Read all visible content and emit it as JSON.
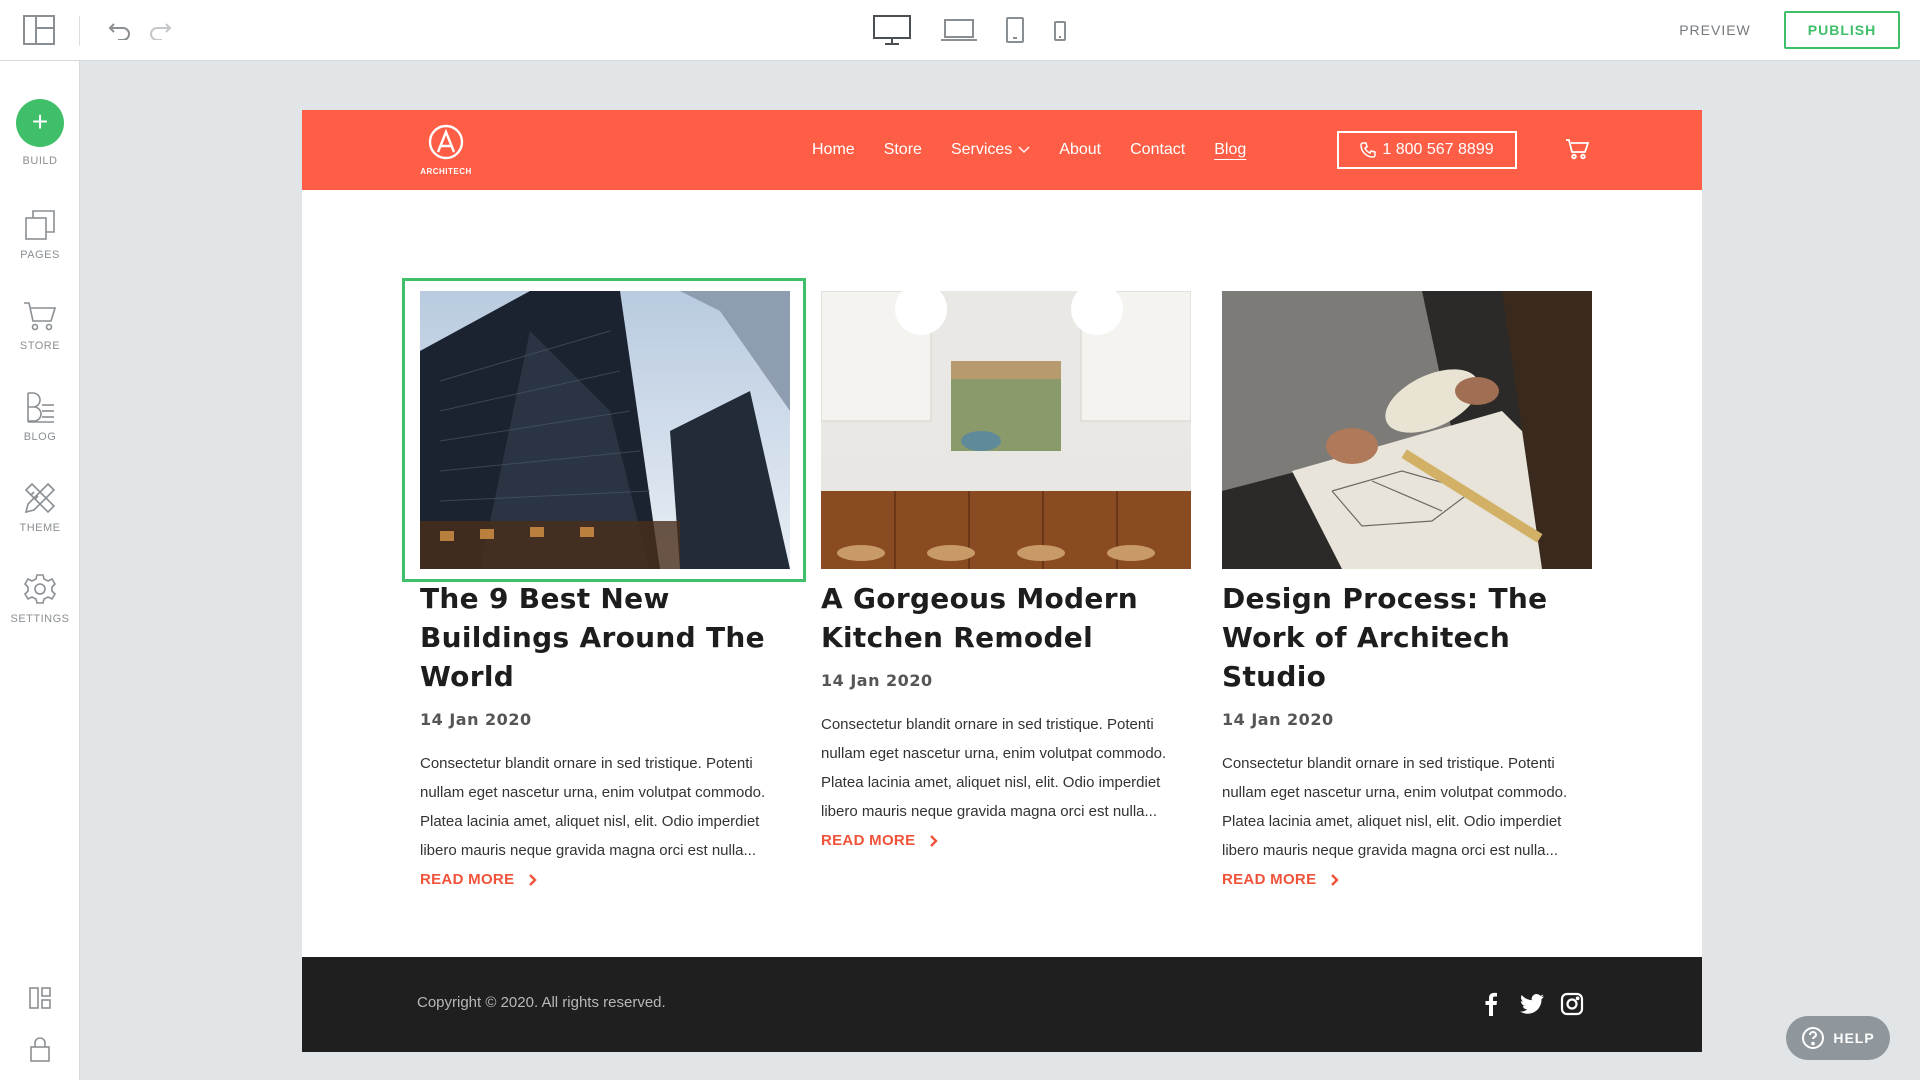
{
  "toolbar": {
    "preview_label": "PREVIEW",
    "publish_label": "PUBLISH",
    "icons": [
      "layout-icon",
      "undo-icon",
      "redo-icon",
      "desktop-icon",
      "laptop-icon",
      "tablet-icon",
      "mobile-icon"
    ]
  },
  "sidebar": {
    "items": [
      {
        "label": "BUILD",
        "icon": "plus-icon"
      },
      {
        "label": "PAGES",
        "icon": "pages-icon"
      },
      {
        "label": "STORE",
        "icon": "cart-icon"
      },
      {
        "label": "BLOG",
        "icon": "blog-icon"
      },
      {
        "label": "THEME",
        "icon": "brush-icon"
      },
      {
        "label": "SETTINGS",
        "icon": "gear-icon"
      }
    ],
    "bottom_icons": [
      "dashboard-icon",
      "lock-icon"
    ]
  },
  "site": {
    "brand": "ARCHITECH",
    "accent_color": "#fe5e45",
    "nav": {
      "home": "Home",
      "store": "Store",
      "services": "Services",
      "about": "About",
      "contact": "Contact",
      "blog": "Blog"
    },
    "phone": "1 800 567 8899",
    "posts": [
      {
        "title": "The 9 Best New Buildings Around The World",
        "date": "14 Jan 2020",
        "excerpt": "Consectetur blandit ornare in sed tristique. Potenti nullam eget nascetur urna, enim volutpat commodo. Platea lacinia amet, aliquet nisl, elit. Odio imperdiet libero mauris neque gravida magna orci est nulla...",
        "read_more": "READ MORE"
      },
      {
        "title": "A Gorgeous Modern Kitchen Remodel",
        "date": "14 Jan 2020",
        "excerpt": "Consectetur blandit ornare in sed tristique. Potenti nullam eget nascetur urna, enim volutpat commodo. Platea lacinia amet, aliquet nisl, elit. Odio imperdiet libero mauris neque gravida magna orci est nulla...",
        "read_more": "READ MORE"
      },
      {
        "title": "Design Process: The Work of Architech Studio",
        "date": "14 Jan 2020",
        "excerpt": "Consectetur blandit ornare in sed tristique. Potenti nullam eget nascetur urna, enim volutpat commodo. Platea lacinia amet, aliquet nisl, elit. Odio imperdiet libero mauris neque gravida magna orci est nulla...",
        "read_more": "READ MORE"
      }
    ],
    "footer": {
      "copyright": "Copyright © 2020. All rights reserved.",
      "social_icons": [
        "facebook-icon",
        "twitter-icon",
        "instagram-icon"
      ]
    }
  },
  "help_label": "HELP"
}
